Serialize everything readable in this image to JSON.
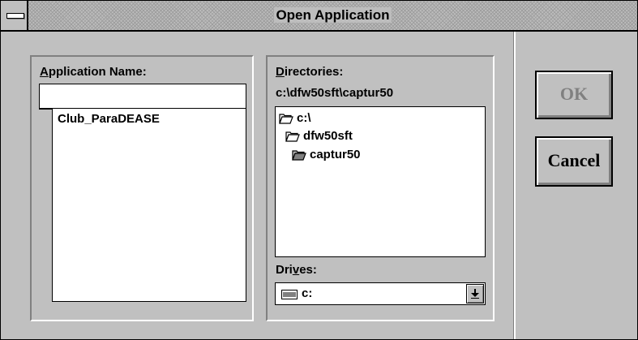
{
  "window": {
    "title": "Open Application"
  },
  "app_name": {
    "label_prefix": "",
    "label_mnemonic": "A",
    "label_rest": "pplication Name:",
    "input_value": "",
    "items": [
      "Club_ParaDEASE"
    ]
  },
  "directories": {
    "label_mnemonic": "D",
    "label_rest": "irectories:",
    "current_path": "c:\\dfw50sft\\captur50",
    "tree": [
      {
        "label": "c:\\",
        "icon": "open-folder-icon"
      },
      {
        "label": "dfw50sft",
        "icon": "open-folder-icon"
      },
      {
        "label": "captur50",
        "icon": "open-folder-icon"
      }
    ]
  },
  "drives": {
    "label_prefix": "Dri",
    "label_mnemonic": "v",
    "label_rest": "es:",
    "selected": "c:",
    "icon": "hard-drive-icon"
  },
  "buttons": {
    "ok": "OK",
    "cancel": "Cancel"
  },
  "colors": {
    "background": "#c0c0c0",
    "disabled_text": "#808080"
  }
}
